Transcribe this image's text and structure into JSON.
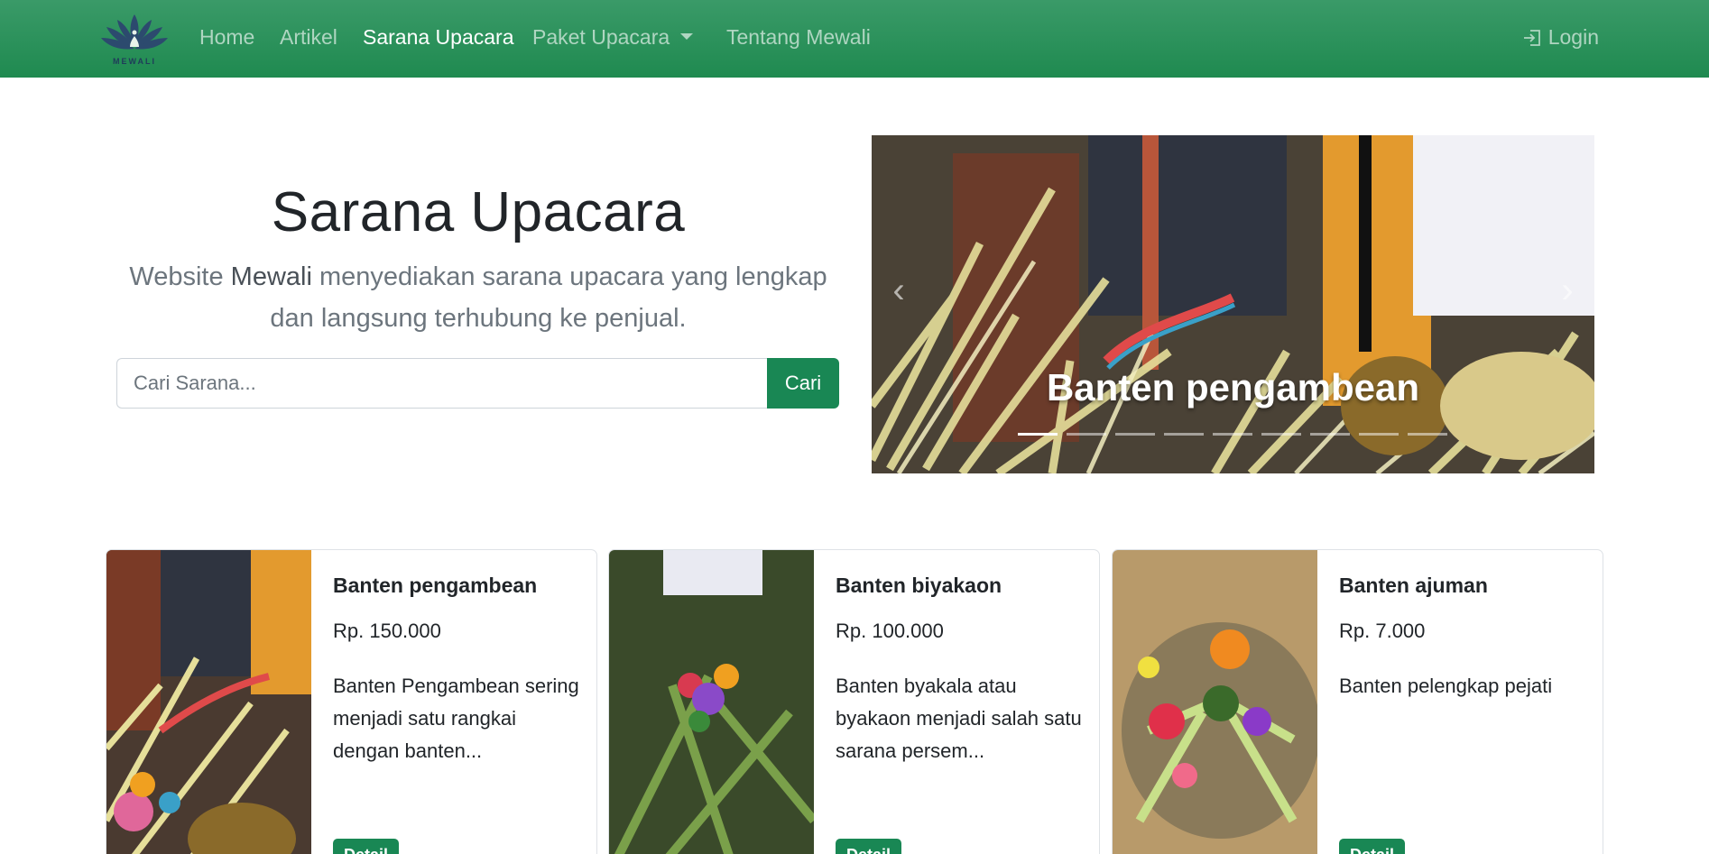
{
  "nav": {
    "brand": "MEWALI",
    "items": [
      {
        "label": "Home"
      },
      {
        "label": "Artikel"
      },
      {
        "label": "Sarana Upacara"
      },
      {
        "label": "Paket Upacara"
      },
      {
        "label": "Tentang Mewali"
      }
    ],
    "login": "Login"
  },
  "hero": {
    "title": "Sarana Upacara",
    "sub_pre": "Website ",
    "sub_brand": "Mewali",
    "sub_post": " menyediakan sarana upacara yang lengkap dan langsung terhubung ke penjual.",
    "search_placeholder": "Cari Sarana...",
    "search_button": "Cari"
  },
  "carousel": {
    "caption": "Banten pengambean",
    "slide_count": 9,
    "active_index": 0
  },
  "products": [
    {
      "name": "Banten pengambean",
      "price": "Rp. 150.000",
      "desc": "Banten Pengambean sering menjadi satu rangkai dengan banten...",
      "button": "Detail"
    },
    {
      "name": "Banten biyakaon",
      "price": "Rp. 100.000",
      "desc": "Banten byakala atau byakaon menjadi salah satu sarana persem...",
      "button": "Detail"
    },
    {
      "name": "Banten ajuman",
      "price": "Rp. 7.000",
      "desc": "Banten pelengkap pejati",
      "button": "Detail"
    }
  ],
  "colors": {
    "navbar": "#1f8a50",
    "primary_button": "#198754"
  }
}
